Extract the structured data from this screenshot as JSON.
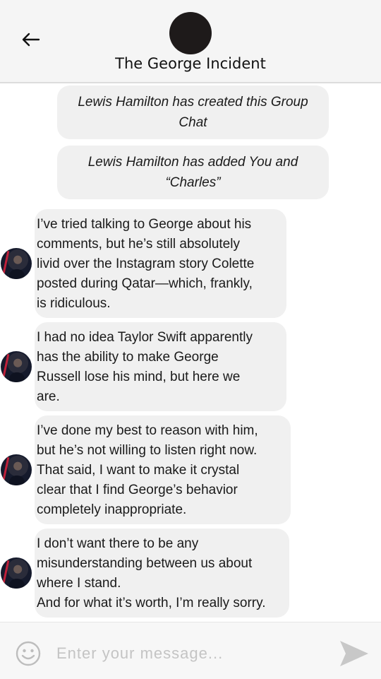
{
  "header": {
    "title": "The George Incident"
  },
  "system_messages": [
    "Lewis Hamilton has created this Group Chat",
    "Lewis Hamilton has added You and “Charles”"
  ],
  "messages": [
    {
      "text": "I’ve tried talking to George about his\ncomments, but he’s still absolutely\nlivid over the Instagram story Colette\nposted during Qatar—which, frankly,\nis ridiculous."
    },
    {
      "text": "I had no idea Taylor Swift apparently\nhas the ability to make George\nRussell lose his mind, but here we\nare."
    },
    {
      "text": "I’ve done my best to reason with him,\nbut he’s not willing to listen right now.\nThat said, I want to make it crystal\nclear that I find George’s behavior\ncompletely inappropriate."
    },
    {
      "text": "I don’t want there to be any\nmisunderstanding between us about\nwhere I stand.\nAnd for what it’s worth, I’m really sorry."
    }
  ],
  "composer": {
    "placeholder": "Enter your message...",
    "value": ""
  },
  "icons": {
    "back": "arrow-left-icon",
    "emoji": "smiley-icon",
    "send": "send-icon"
  },
  "colors": {
    "bubble": "#f0f0f0",
    "header_bg": "#f5f5f5",
    "group_avatar": "#1e1a1a",
    "send_icon": "#c8c8c8"
  }
}
